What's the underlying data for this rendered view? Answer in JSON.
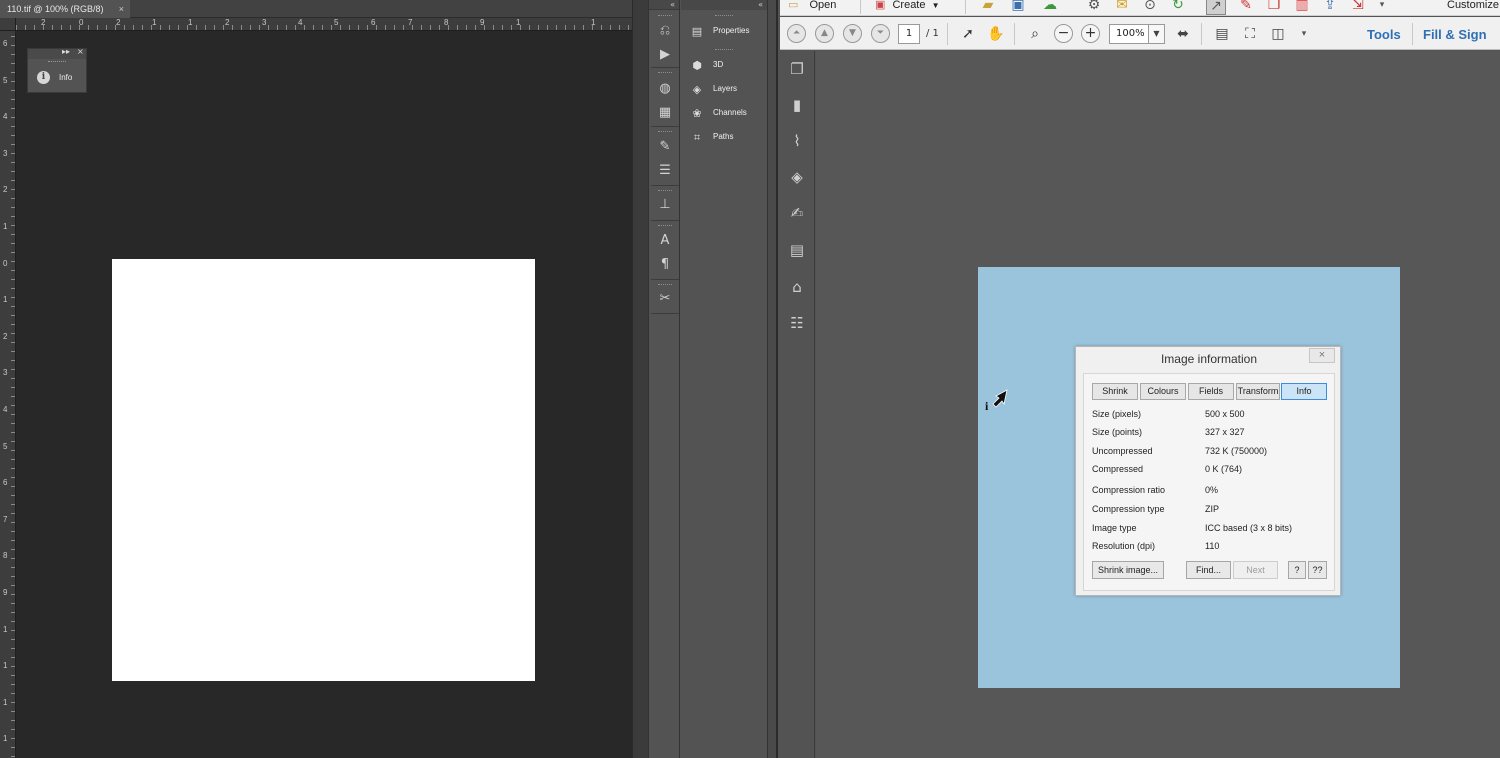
{
  "photoshop": {
    "tab_title": "110.tif @ 100% (RGB/8)",
    "tab_close": "×",
    "ruler_top_labels": [
      "2",
      "0",
      "2",
      "1",
      "1",
      "2",
      "3",
      "4",
      "5",
      "6",
      "7",
      "8",
      "9",
      "1",
      "1"
    ],
    "ruler_left_labels": [
      "6",
      "5",
      "4",
      "3",
      "2",
      "1",
      "0",
      "1",
      "2",
      "3",
      "4",
      "5",
      "6",
      "7",
      "8",
      "9",
      "1",
      "1",
      "1",
      "1"
    ],
    "floating_panel": {
      "collapse": "▸▸",
      "close": "×",
      "label": "Info"
    },
    "toolstrip_collapse": "«",
    "panels_collapse": "«",
    "panels": [
      {
        "label": "Properties",
        "icon": "properties-icon"
      },
      {
        "label": "3D",
        "icon": "cube-icon"
      },
      {
        "label": "Layers",
        "icon": "layers-icon"
      },
      {
        "label": "Channels",
        "icon": "channels-icon"
      },
      {
        "label": "Paths",
        "icon": "paths-icon"
      }
    ]
  },
  "acrobat": {
    "menu": {
      "open": "Open",
      "create": "Create",
      "customize": "Customize"
    },
    "toolbar": {
      "page_current": "1",
      "page_total": "/ 1",
      "zoom": "100%",
      "tools_link": "Tools",
      "fill_sign_link": "Fill & Sign"
    },
    "dialog": {
      "title": "Image information",
      "close": "×",
      "tabs": [
        {
          "label": "Shrink",
          "active": false
        },
        {
          "label": "Colours",
          "active": false
        },
        {
          "label": "Fields",
          "active": false
        },
        {
          "label": "Transform",
          "active": false
        },
        {
          "label": "Info",
          "active": true
        }
      ],
      "rows": [
        {
          "label": "Size (pixels)",
          "value": "500 x 500"
        },
        {
          "label": "Size (points)",
          "value": "327 x 327"
        },
        {
          "label": "Uncompressed",
          "value": "732 K (750000)"
        },
        {
          "label": "Compressed",
          "value": "0 K (764)"
        },
        {
          "label": "Compression ratio",
          "value": "0%"
        },
        {
          "label": "Compression type",
          "value": "ZIP"
        },
        {
          "label": "Image type",
          "value": "ICC based (3 x 8 bits)"
        },
        {
          "label": "Resolution (dpi)",
          "value": "110"
        }
      ],
      "buttons": {
        "shrink": "Shrink image...",
        "find": "Find...",
        "next": "Next",
        "help": "?",
        "help2": "??"
      }
    },
    "colors": {
      "page": "#9ac3dc",
      "link": "#2f6fb5",
      "active_tab": "#cce4f7"
    }
  }
}
